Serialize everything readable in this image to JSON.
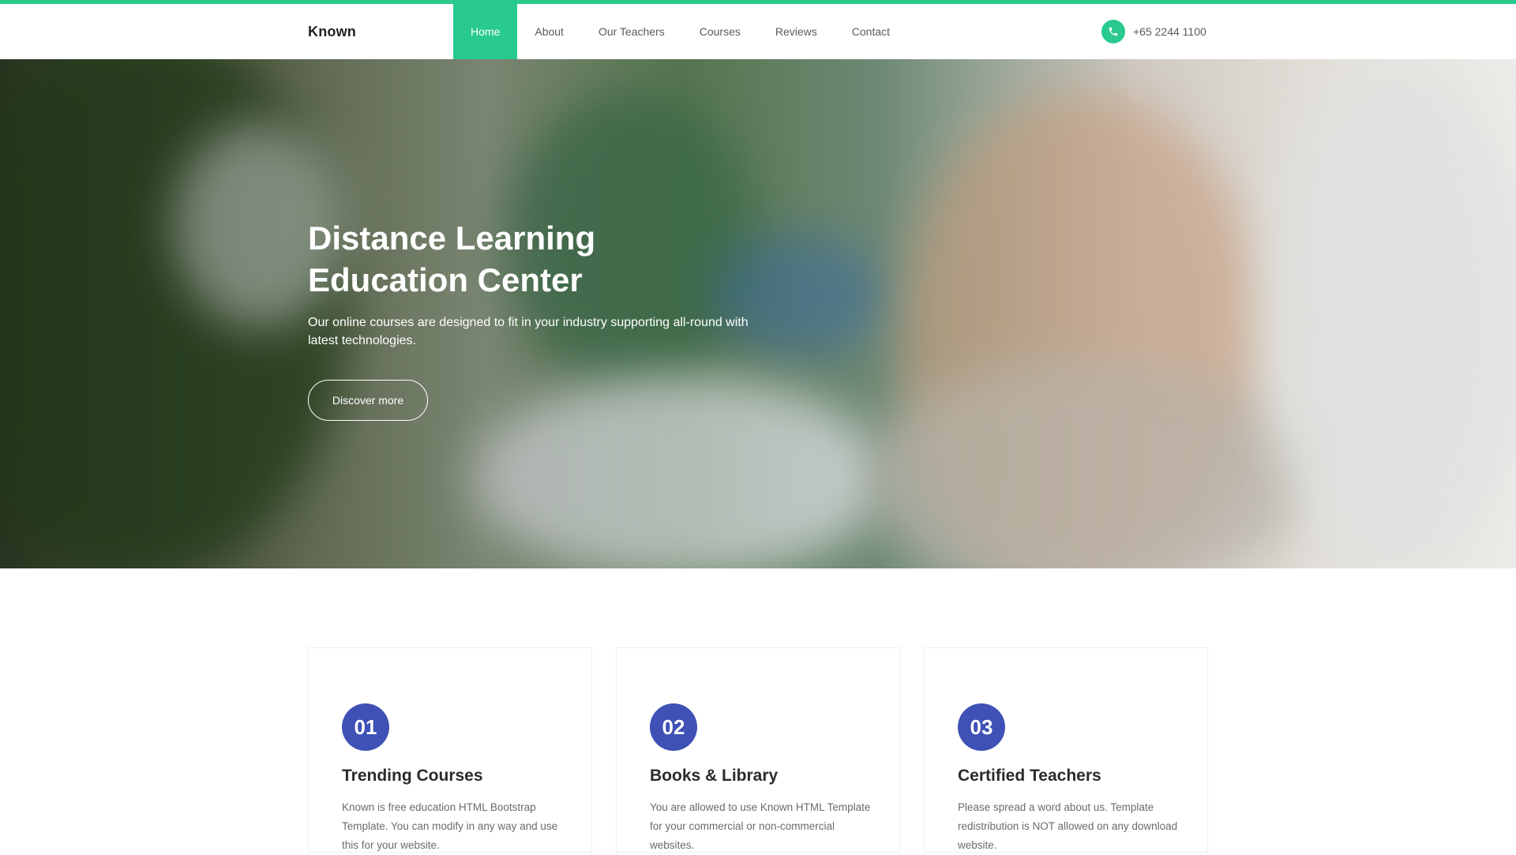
{
  "brand": "Known",
  "nav": {
    "items": [
      "Home",
      "About",
      "Our Teachers",
      "Courses",
      "Reviews",
      "Contact"
    ],
    "active": "Home"
  },
  "contact": {
    "phone": "+65 2244 1100"
  },
  "hero": {
    "title_line1": "Distance Learning",
    "title_line2": "Education Center",
    "subtitle": "Our online courses are designed to fit in your industry supporting all-round with latest technologies.",
    "button": "Discover more"
  },
  "features": [
    {
      "num": "01",
      "title": "Trending Courses",
      "text": "Known is free education HTML Bootstrap Template. You can modify in any way and use this for your website."
    },
    {
      "num": "02",
      "title": "Books & Library",
      "text": "You are allowed to use Known HTML Template for your commercial or non-commercial websites."
    },
    {
      "num": "03",
      "title": "Certified Teachers",
      "text": "Please spread a word about us. Template redistribution is NOT allowed on any download website."
    }
  ],
  "colors": {
    "accent": "#29ca8e",
    "feature_circle": "#3f51b5"
  },
  "icons": {
    "phone": "phone-icon"
  }
}
